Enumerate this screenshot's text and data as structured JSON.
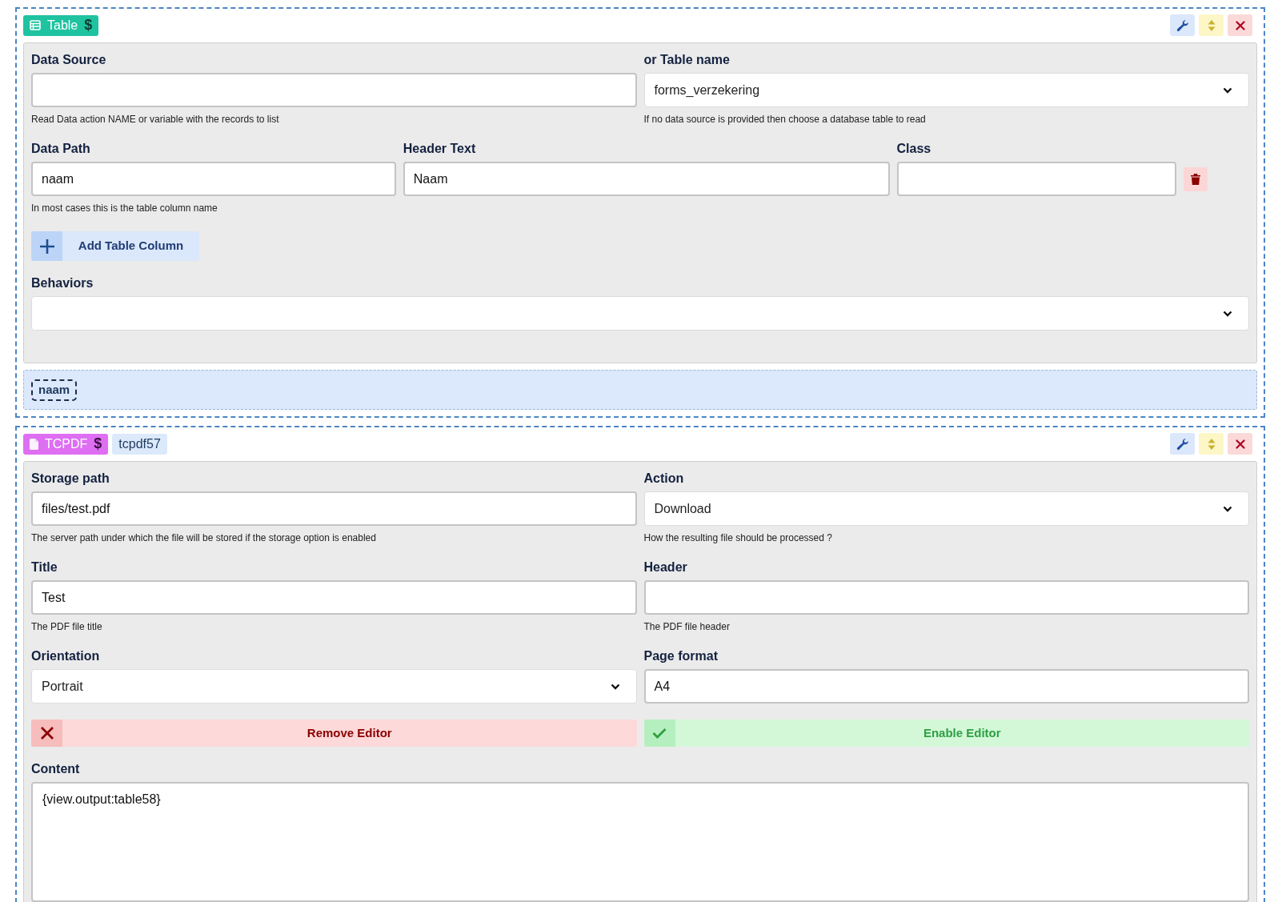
{
  "blocks": [
    {
      "badge": {
        "kind": "table",
        "label": "Table",
        "symbol": "$"
      },
      "items": [
        {
          "kind": "fields",
          "fields": [
            {
              "label": "Data Source",
              "kind": "input",
              "hint": "Read Data action NAME or variable with the records to list"
            },
            {
              "label": "or Table name",
              "kind": "select",
              "value": "forms_verzekering",
              "hint": "If no data source is provided then choose a database table to read"
            }
          ]
        },
        {
          "kind": "fields",
          "removable": true,
          "fields": [
            {
              "label": "Data Path",
              "kind": "input",
              "value": "naam",
              "hint": "In most cases this is the table column name"
            },
            {
              "label": "Header Text",
              "kind": "input",
              "value": "Naam"
            },
            {
              "label": "Class",
              "kind": "input"
            }
          ]
        },
        {
          "kind": "buttons",
          "buttons": [
            {
              "kind": "add",
              "label": "Add Table Column"
            }
          ]
        },
        {
          "kind": "fields",
          "fields": [
            {
              "label": "Behaviors",
              "kind": "select"
            }
          ]
        }
      ],
      "dropzone": [
        "naam"
      ]
    },
    {
      "badge": {
        "kind": "pdf",
        "label": "TCPDF",
        "symbol": "$"
      },
      "tag": "tcpdf57",
      "items": [
        {
          "kind": "fields",
          "fields": [
            {
              "label": "Storage path",
              "kind": "input",
              "value": "files/test.pdf",
              "hint": "The server path under which the file will be stored if the storage option is enabled"
            },
            {
              "label": "Action",
              "kind": "select",
              "value": "Download",
              "hint": "How the resulting file should be processed ?"
            }
          ]
        },
        {
          "kind": "fields",
          "fields": [
            {
              "label": "Title",
              "kind": "input",
              "value": "Test",
              "hint": "The PDF file title"
            },
            {
              "label": "Header",
              "kind": "input",
              "hint": "The PDF file header"
            }
          ]
        },
        {
          "kind": "fields",
          "fields": [
            {
              "label": "Orientation",
              "kind": "select",
              "value": "Portrait"
            },
            {
              "label": "Page format",
              "kind": "input",
              "value": "A4"
            }
          ]
        },
        {
          "kind": "buttons",
          "buttons": [
            {
              "kind": "remove",
              "label": "Remove Editor"
            },
            {
              "kind": "enable",
              "label": "Enable Editor"
            }
          ]
        },
        {
          "kind": "fields",
          "fields": [
            {
              "label": "Content",
              "kind": "textarea",
              "value": "{view.output:table58}"
            }
          ]
        }
      ]
    }
  ]
}
